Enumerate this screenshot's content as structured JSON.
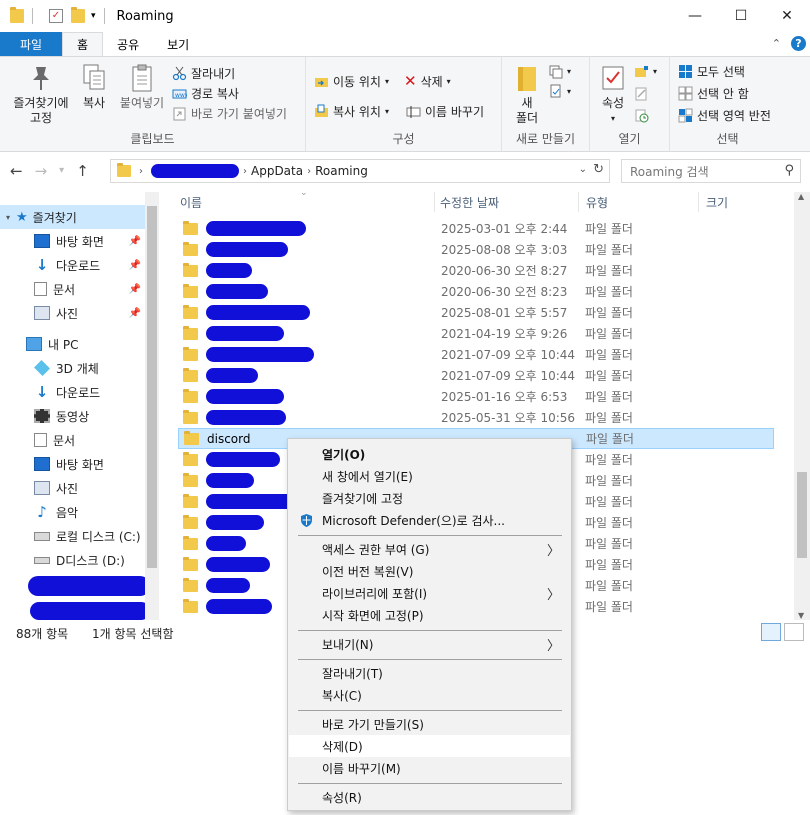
{
  "window": {
    "title": "Roaming",
    "minimize": "—",
    "maximize": "☐",
    "close": "✕"
  },
  "tabs": {
    "file": "파일",
    "home": "홈",
    "share": "공유",
    "view": "보기",
    "expand": "⌃",
    "help": "?"
  },
  "ribbon": {
    "clipboard": {
      "label": "클립보드",
      "pin": "즐겨찾기에\n고정",
      "copy": "복사",
      "paste": "붙여넣기",
      "cut": "잘라내기",
      "copy_path": "경로 복사",
      "paste_shortcut": "바로 가기 붙여넣기"
    },
    "organize": {
      "label": "구성",
      "move_to": "이동 위치",
      "copy_to": "복사 위치",
      "delete": "삭제",
      "rename": "이름 바꾸기"
    },
    "new": {
      "label": "새로 만들기",
      "new_folder": "새\n폴더"
    },
    "open": {
      "label": "열기",
      "properties": "속성"
    },
    "select": {
      "label": "선택",
      "select_all": "모두 선택",
      "select_none": "선택 안 함",
      "invert": "선택 영역 반전"
    }
  },
  "address": {
    "segments": [
      "AppData",
      "Roaming"
    ],
    "search_placeholder": "Roaming 검색"
  },
  "nav": {
    "items": [
      {
        "label": "즐겨찾기",
        "icon": "star-icon"
      },
      {
        "label": "바탕 화면",
        "icon": "desktop-icon"
      },
      {
        "label": "다운로드",
        "icon": "download-icon"
      },
      {
        "label": "문서",
        "icon": "document-icon"
      },
      {
        "label": "사진",
        "icon": "pictures-icon"
      },
      {
        "label": "내 PC",
        "icon": "computer-icon"
      },
      {
        "label": "3D 개체",
        "icon": "cube-icon"
      },
      {
        "label": "다운로드",
        "icon": "download-icon"
      },
      {
        "label": "동영상",
        "icon": "video-icon"
      },
      {
        "label": "문서",
        "icon": "document-icon"
      },
      {
        "label": "바탕 화면",
        "icon": "desktop-icon"
      },
      {
        "label": "사진",
        "icon": "pictures-icon"
      },
      {
        "label": "음악",
        "icon": "music-icon"
      },
      {
        "label": "로컬 디스크 (C:)",
        "icon": "drive-icon"
      },
      {
        "label": "D디스크 (D:)",
        "icon": "drive-icon"
      }
    ],
    "pin": "📌"
  },
  "columns": {
    "name": "이름",
    "date": "수정한 날짜",
    "type": "유형",
    "size": "크기"
  },
  "files": [
    {
      "name": "",
      "date": "2025-03-01 오후 2:44",
      "type": "파일 폴더"
    },
    {
      "name": "",
      "date": "2025-08-08 오후 3:03",
      "type": "파일 폴더"
    },
    {
      "name": "",
      "date": "2020-06-30 오전 8:27",
      "type": "파일 폴더"
    },
    {
      "name": "",
      "date": "2020-06-30 오전 8:23",
      "type": "파일 폴더"
    },
    {
      "name": "",
      "date": "2025-08-01 오후 5:57",
      "type": "파일 폴더"
    },
    {
      "name": "",
      "date": "2021-04-19 오후 9:26",
      "type": "파일 폴더"
    },
    {
      "name": "",
      "date": "2021-07-09 오후 10:44",
      "type": "파일 폴더"
    },
    {
      "name": "",
      "date": "2021-07-09 오후 10:44",
      "type": "파일 폴더"
    },
    {
      "name": "",
      "date": "2025-01-16 오후 6:53",
      "type": "파일 폴더"
    },
    {
      "name": "",
      "date": "2025-05-31 오후 10:56",
      "type": "파일 폴더"
    },
    {
      "name": "discord",
      "date": "",
      "type": "파일 폴더"
    },
    {
      "name": "",
      "date": "",
      "type": "파일 폴더"
    },
    {
      "name": "",
      "date": "",
      "type": "파일 폴더"
    },
    {
      "name": "",
      "date": "",
      "type": "파일 폴더"
    },
    {
      "name": "",
      "date": "",
      "type": "파일 폴더"
    },
    {
      "name": "",
      "date": "",
      "type": "파일 폴더"
    },
    {
      "name": "",
      "date": "",
      "type": "파일 폴더"
    },
    {
      "name": "",
      "date": "",
      "type": "파일 폴더"
    },
    {
      "name": "",
      "date": "",
      "type": "파일 폴더"
    }
  ],
  "status": {
    "count": "88개 항목",
    "selected": "1개 항목 선택함"
  },
  "context_menu": {
    "open": "열기(O)",
    "open_new_window": "새 창에서 열기(E)",
    "pin_favorites": "즐겨찾기에 고정",
    "defender": "Microsoft Defender(으)로 검사...",
    "give_access": "액세스 권한 부여 (G)",
    "restore_versions": "이전 버전 복원(V)",
    "include_library": "라이브러리에 포함(I)",
    "pin_start": "시작 화면에 고정(P)",
    "send_to": "보내기(N)",
    "cut": "잘라내기(T)",
    "copy": "복사(C)",
    "create_shortcut": "바로 가기 만들기(S)",
    "delete": "삭제(D)",
    "rename": "이름 바꾸기(M)",
    "properties": "속성(R)",
    "submenu_arrow": "〉"
  },
  "colors": {
    "accent": "#1979ca",
    "selection": "#cce8ff",
    "redaction": "#1010d8",
    "folder": "#f3c94b"
  }
}
